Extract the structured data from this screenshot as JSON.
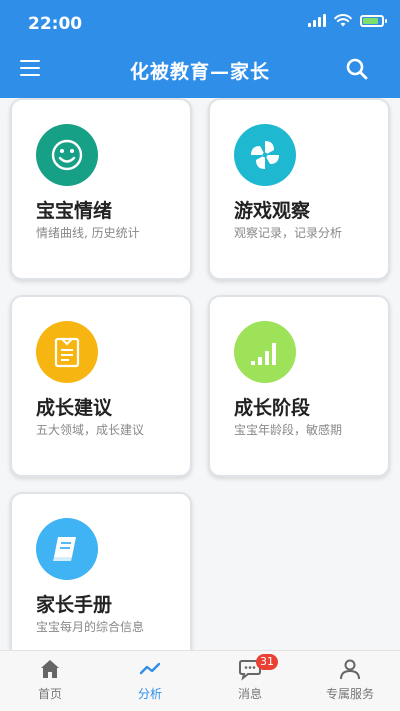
{
  "status_bar": {
    "time": "22:00"
  },
  "header": {
    "title": "化被教育—家长"
  },
  "cards": [
    {
      "title": "宝宝情绪",
      "subtitle": "情绪曲线, 历史统计",
      "icon": "smiley-icon",
      "color": "#16a085"
    },
    {
      "title": "游戏观察",
      "subtitle": "观察记录，记录分析",
      "icon": "pinwheel-icon",
      "color": "#1fb8d1"
    },
    {
      "title": "成长建议",
      "subtitle": "五大领域，成长建议",
      "icon": "clipboard-icon",
      "color": "#f7b511"
    },
    {
      "title": "成长阶段",
      "subtitle": "宝宝年龄段，敏感期",
      "icon": "bar-growth-icon",
      "color": "#9ee25a"
    },
    {
      "title": "家长手册",
      "subtitle": "宝宝每月的综合信息",
      "icon": "book-icon",
      "color": "#3fb3f3"
    }
  ],
  "tabs": [
    {
      "label": "首页",
      "icon": "home-icon"
    },
    {
      "label": "分析",
      "icon": "trend-icon",
      "active": true
    },
    {
      "label": "消息",
      "icon": "chat-icon",
      "badge": "31"
    },
    {
      "label": "专属服务",
      "icon": "user-icon"
    }
  ],
  "colors": {
    "primary": "#2f8fe8",
    "badge": "#e94235"
  }
}
